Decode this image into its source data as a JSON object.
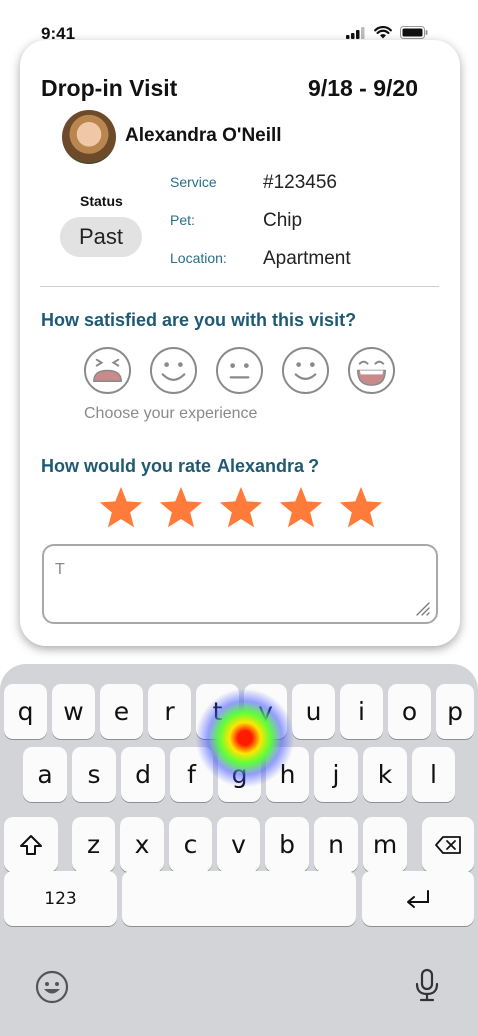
{
  "status_bar": {
    "time": "9:41",
    "icons": [
      "cellular-signal-icon",
      "wifi-icon",
      "battery-icon"
    ]
  },
  "visit": {
    "title": "Drop-in Visit",
    "dates": "9/18 - 9/20",
    "owner_name": "Alexandra O'Neill",
    "status_label": "Status",
    "status_value": "Past",
    "details": [
      {
        "label": "Service",
        "value": "#123456"
      },
      {
        "label": "Pet:",
        "value": "Chip"
      },
      {
        "label": "Location:",
        "value": "Apartment"
      }
    ]
  },
  "feedback": {
    "satisfaction_question": "How satisfied are you with this visit?",
    "faces": [
      "very-unhappy-face-icon",
      "happy-face-icon",
      "neutral-face-icon",
      "smile-face-icon",
      "very-happy-face-icon"
    ],
    "faces_hint": "Choose your experience",
    "rating_question_prefix": "How would you rate",
    "rating_name": "Alexandra",
    "rating_question_suffix": "?",
    "stars": 5,
    "star_color": "#ff7b3a",
    "comment_text": "T"
  },
  "keyboard": {
    "row1": [
      "q",
      "w",
      "e",
      "r",
      "t",
      "y",
      "u",
      "i",
      "o",
      "p"
    ],
    "row2": [
      "a",
      "s",
      "d",
      "f",
      "g",
      "h",
      "j",
      "k",
      "l"
    ],
    "row3": [
      "z",
      "x",
      "c",
      "v",
      "b",
      "n",
      "m"
    ],
    "numbers_label": "123",
    "icons": [
      "shift-icon",
      "backspace-icon",
      "return-icon",
      "emoji-icon",
      "microphone-icon"
    ]
  },
  "colors": {
    "accent_text": "#1f5a73",
    "label_text": "#2a6e8a",
    "star": "#ff7b3a",
    "keyboard_bg": "#d3d4d8"
  }
}
